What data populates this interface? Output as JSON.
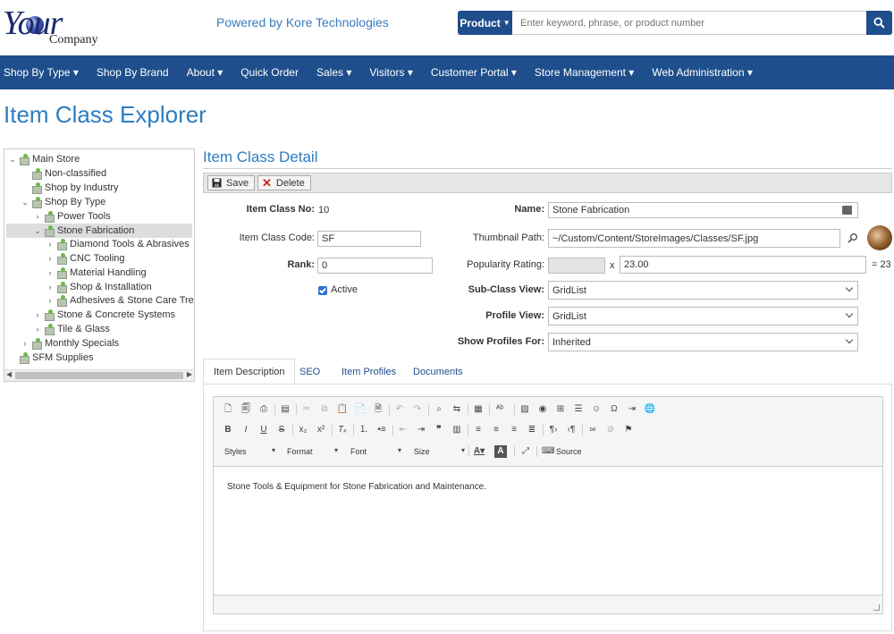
{
  "header": {
    "logo_your": "Your",
    "logo_company": "Company",
    "powered_by": "Powered by Kore Technologies",
    "search_scope": "Product",
    "search_placeholder": "Enter keyword, phrase, or product number"
  },
  "nav": [
    "Shop By Type ▾",
    "Shop By Brand",
    "About ▾",
    "Quick Order",
    "Sales ▾",
    "Visitors ▾",
    "Customer Portal ▾",
    "Store Management ▾",
    "Web Administration ▾"
  ],
  "page_title": "Item Class Explorer",
  "tree": [
    {
      "label": "Main Store",
      "toggle": "⌄"
    },
    {
      "label": "Non-classified",
      "toggle": ""
    },
    {
      "label": "Shop by Industry",
      "toggle": ""
    },
    {
      "label": "Shop By Type",
      "toggle": "⌄"
    },
    {
      "label": "Power Tools",
      "toggle": "›"
    },
    {
      "label": "Stone Fabrication",
      "toggle": "⌄"
    },
    {
      "label": "Diamond Tools & Abrasives",
      "toggle": "›"
    },
    {
      "label": "CNC Tooling",
      "toggle": "›"
    },
    {
      "label": "Material Handling",
      "toggle": "›"
    },
    {
      "label": "Shop & Installation",
      "toggle": "›"
    },
    {
      "label": "Adhesives & Stone Care Treatm",
      "toggle": "›"
    },
    {
      "label": "Stone & Concrete Systems",
      "toggle": "›"
    },
    {
      "label": "Tile & Glass",
      "toggle": "›"
    },
    {
      "label": "Monthly Specials",
      "toggle": "›"
    },
    {
      "label": "SFM Supplies",
      "toggle": ""
    }
  ],
  "detail": {
    "title": "Item Class Detail",
    "save_label": "Save",
    "delete_label": "Delete",
    "item_class_no_label": "Item Class No:",
    "item_class_no": "10",
    "item_class_code_label": "Item Class Code:",
    "item_class_code": "SF",
    "rank_label": "Rank:",
    "rank": "0",
    "active_label": "Active",
    "name_label": "Name:",
    "name": "Stone Fabrication",
    "thumbnail_label": "Thumbnail Path:",
    "thumbnail_path": "~/Custom/Content/StoreImages/Classes/SF.jpg",
    "popularity_label": "Popularity Rating:",
    "popularity_x": "x",
    "popularity_multiplier": "23.00",
    "popularity_result": "= 23",
    "subclass_view_label": "Sub-Class View:",
    "subclass_view": "GridList",
    "profile_view_label": "Profile View:",
    "profile_view": "GridList",
    "show_profiles_label": "Show Profiles For:",
    "show_profiles": "Inherited"
  },
  "tabs": [
    "Item Description",
    "SEO",
    "Item Profiles",
    "Documents"
  ],
  "editor": {
    "styles": "Styles",
    "format": "Format",
    "font": "Font",
    "size": "Size",
    "source": "Source",
    "content": "Stone Tools & Equipment for Stone Fabrication and Maintenance."
  },
  "colors": {
    "nav_bg": "#1f4e8c",
    "title": "#2d7dc0",
    "link": "#3a7bbf"
  }
}
